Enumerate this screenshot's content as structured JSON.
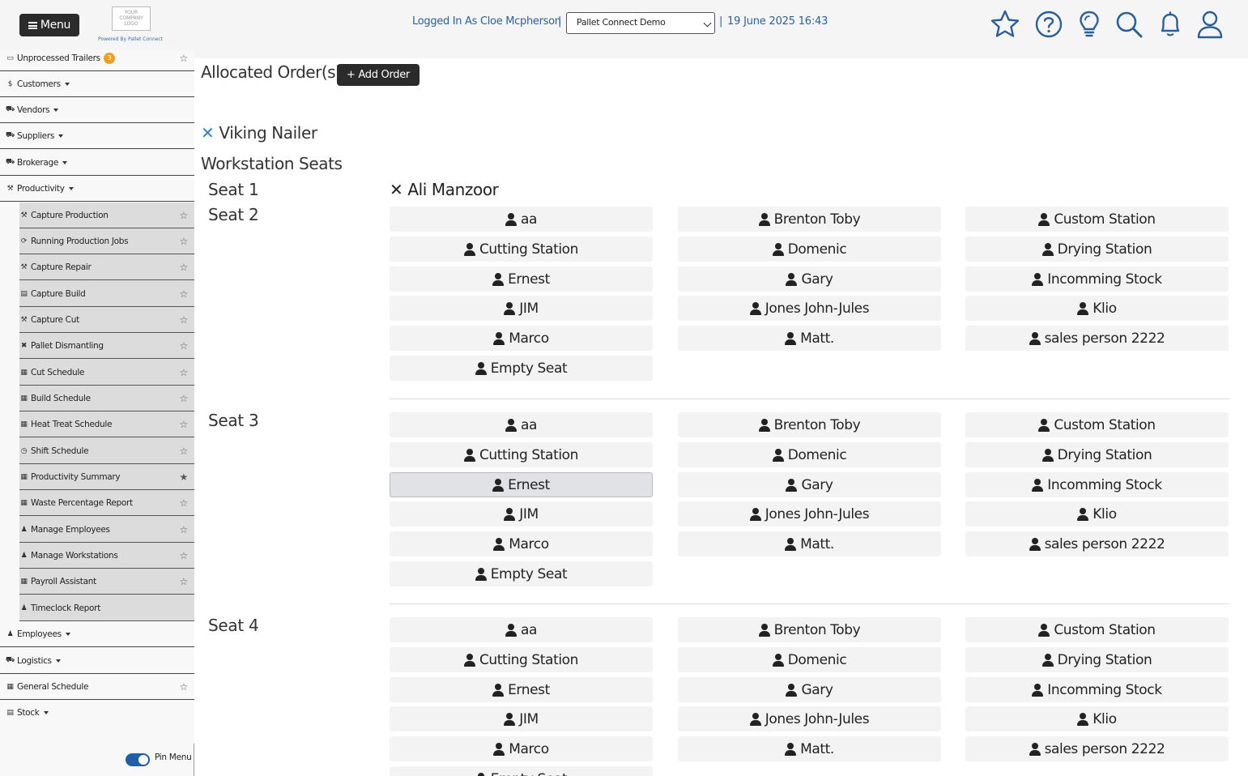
{
  "header": {
    "menu_label": "Menu",
    "logo_text": "YOUR COMPANY LOGO",
    "powered_by": "Powered By Pallet Connect",
    "logged_in": "Logged In As Cloe Mcpherson",
    "separator": "|",
    "company_selected": "Pallet Connect Demo",
    "datetime": "19 June 2025 16:43",
    "icons": [
      "star-icon",
      "help-icon",
      "lightbulb-icon",
      "search-icon",
      "bell-icon",
      "user-icon"
    ]
  },
  "sidebar": {
    "items": [
      {
        "label": "Unprocessed Trailers",
        "icon": "trailer-icon",
        "badge": "3"
      },
      {
        "label": "Customers",
        "icon": "dollar-icon"
      },
      {
        "label": "Vendors",
        "icon": "truck-icon"
      },
      {
        "label": "Suppliers",
        "icon": "truck-icon"
      },
      {
        "label": "Brokerage",
        "icon": "truck-icon"
      },
      {
        "label": "Productivity",
        "icon": "hammer-icon"
      },
      {
        "label": "Capture Production"
      },
      {
        "label": "Running Production Jobs"
      },
      {
        "label": "Capture Repair"
      },
      {
        "label": "Capture Build"
      },
      {
        "label": "Capture Cut"
      },
      {
        "label": "Pallet Dismantling"
      },
      {
        "label": "Cut Schedule"
      },
      {
        "label": "Build Schedule"
      },
      {
        "label": "Heat Treat Schedule"
      },
      {
        "label": "Shift Schedule"
      },
      {
        "label": "Productivity Summary"
      },
      {
        "label": "Waste Percentage Report"
      },
      {
        "label": "Manage Employees"
      },
      {
        "label": "Manage Workstations"
      },
      {
        "label": "Payroll Assistant"
      },
      {
        "label": "Timeclock Report"
      },
      {
        "label": "Employees"
      },
      {
        "label": "Logistics"
      },
      {
        "label": "General Schedule"
      },
      {
        "label": "Stock"
      }
    ],
    "pin_menu_label": "Pin Menu"
  },
  "main": {
    "title": "Allocated Order(s)",
    "add_order_label": "+ Add Order",
    "workstation_name": "Viking Nailer",
    "workstation_seats_heading": "Workstation Seats",
    "seat1_label": "Seat 1",
    "seat1_employee": "Ali Manzoor",
    "seats": [
      {
        "label": "Seat 2"
      },
      {
        "label": "Seat 3"
      },
      {
        "label": "Seat 4"
      }
    ],
    "employees": [
      "aa",
      "Brenton Toby",
      "Custom Station",
      "Cutting Station",
      "Domenic",
      "Drying Station",
      "Ernest",
      "Gary",
      "Incomming Stock",
      "JIM",
      "Jones John-Jules",
      "Klio",
      "Marco",
      "Matt.",
      "sales person 2222",
      "Empty Seat"
    ],
    "seat3_selected": "Ernest"
  },
  "colors": {
    "link_blue": "#2a5f9e",
    "toggle_blue": "#1f5fa5",
    "dark_button": "#2b2b2b"
  }
}
